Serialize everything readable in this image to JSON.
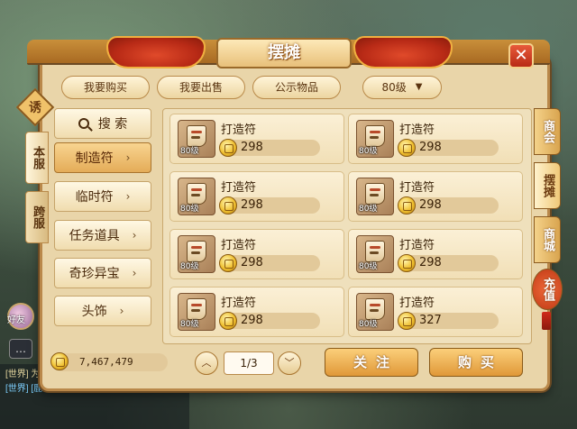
{
  "window": {
    "title": "摆摊",
    "close_glyph": "✕"
  },
  "top_tabs": [
    {
      "label": "我要购买"
    },
    {
      "label": "我要出售"
    },
    {
      "label": "公示物品"
    }
  ],
  "level_filter": {
    "value": "80级",
    "arrow": "▼"
  },
  "side_badge": "诱",
  "server_tabs": [
    {
      "label": "本服"
    },
    {
      "label": "跨服"
    }
  ],
  "categories": {
    "search_label": "搜 索",
    "items": [
      {
        "label": "制造符",
        "active": true
      },
      {
        "label": "临时符",
        "active": false
      },
      {
        "label": "任务道具",
        "active": false
      },
      {
        "label": "奇珍异宝",
        "active": false
      },
      {
        "label": "头饰",
        "active": false
      }
    ],
    "chevron": "›"
  },
  "listings": [
    {
      "name": "打造符",
      "level": "80级",
      "price": "298"
    },
    {
      "name": "打造符",
      "level": "80级",
      "price": "298"
    },
    {
      "name": "打造符",
      "level": "80级",
      "price": "298"
    },
    {
      "name": "打造符",
      "level": "80级",
      "price": "298"
    },
    {
      "name": "打造符",
      "level": "80级",
      "price": "298"
    },
    {
      "name": "打造符",
      "level": "80级",
      "price": "298"
    },
    {
      "name": "打造符",
      "level": "80级",
      "price": "298"
    },
    {
      "name": "打造符",
      "level": "80级",
      "price": "327"
    }
  ],
  "right_tabs": [
    {
      "label": "商会"
    },
    {
      "label": "摆摊"
    },
    {
      "label": "商城"
    },
    {
      "label": "充值"
    }
  ],
  "footer": {
    "money": "7,467,479",
    "page": "1/3",
    "prev_glyph": "︿",
    "next_glyph": "﹀",
    "follow_label": "关注",
    "buy_label": "购买"
  },
  "scene": {
    "avatar_label": "好友",
    "chat_lines": [
      "[世界] 为何遗漏掉 [荣誉] [诸名战役]",
      "[世界] [鹿研研] [如鲸深小窗]"
    ]
  },
  "colors": {
    "panel_bg": "#e9d5a9",
    "accent": "#e09838",
    "active_category": "#e4ac58",
    "ribbon": "#b82a16"
  }
}
